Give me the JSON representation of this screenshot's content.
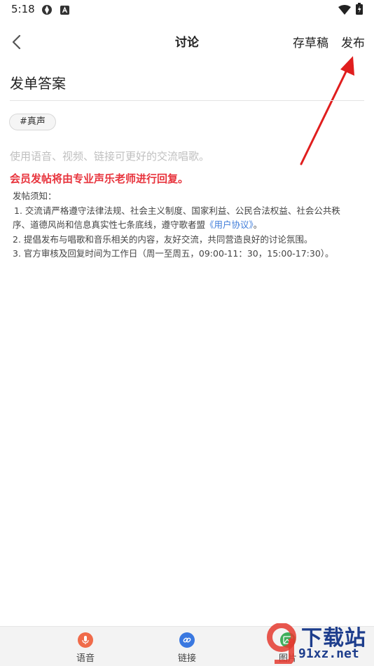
{
  "status_bar": {
    "time": "5:18"
  },
  "header": {
    "title": "讨论",
    "save_draft_label": "存草稿",
    "publish_label": "发布"
  },
  "post": {
    "title_value": "发单答案",
    "tag": "#真声",
    "body_placeholder": "使用语音、视频、链接可更好的交流唱歌。"
  },
  "notice": {
    "red_text": "会员发帖将由专业声乐老师进行回复。",
    "heading": "发帖须知：",
    "rule1_a": "1. 交流请严格遵守法律法规、社会主义制度、国家利益、公民合法权益、社会公共秩",
    "rule1_b": "序、道德风尚和信息真实性七条底线，遵守歌者盟",
    "rule1_link": "《用户协议》",
    "rule1_end": "。",
    "rule2": "2. 提倡发布与唱歌和音乐相关的内容，友好交流，共同营造良好的讨论氛围。",
    "rule3": "3. 官方审核及回复时间为工作日（周一至周五，09:00-11：30，15:00-17:30）。"
  },
  "toolbar": {
    "voice_label": "语音",
    "link_label": "链接",
    "image_label": "图片"
  },
  "watermark": {
    "text": "下载站",
    "url": "91xz.net"
  },
  "colors": {
    "accent_red": "#e8343d",
    "link_blue": "#3d7bd9",
    "voice_orange": "#f06b4a",
    "link_icon_blue": "#3a78e0",
    "image_green": "#3fae5b"
  }
}
